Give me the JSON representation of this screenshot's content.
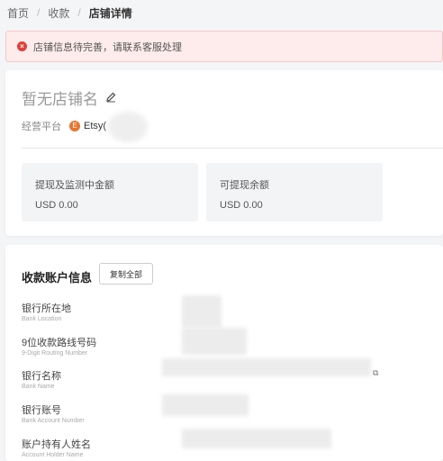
{
  "breadcrumb": [
    "首页",
    "收款",
    "店铺详情"
  ],
  "alert": {
    "icon": "error-icon",
    "text": "店铺信息待完善，请联系客服处理",
    "color": "#e2403a"
  },
  "store": {
    "name": "暂无店铺名",
    "platform_label": "经营平台",
    "platform_icon": "E",
    "platform_name": "Etsy("
  },
  "stats": [
    {
      "label": "提现及监测中金额",
      "value": "USD 0.00"
    },
    {
      "label": "可提现余额",
      "value": "USD 0.00"
    }
  ],
  "account": {
    "title": "收款账户信息",
    "copy_all": "复制全部",
    "fields": [
      {
        "zh": "银行所在地",
        "en": "Bank Location"
      },
      {
        "zh": "9位收款路线号码",
        "en": "9-Digit Routing Number"
      },
      {
        "zh": "银行名称",
        "en": "Bank Name"
      },
      {
        "zh": "银行账号",
        "en": "Bank Account Number"
      },
      {
        "zh": "账户持有人姓名",
        "en": "Account Holder Name"
      }
    ]
  }
}
